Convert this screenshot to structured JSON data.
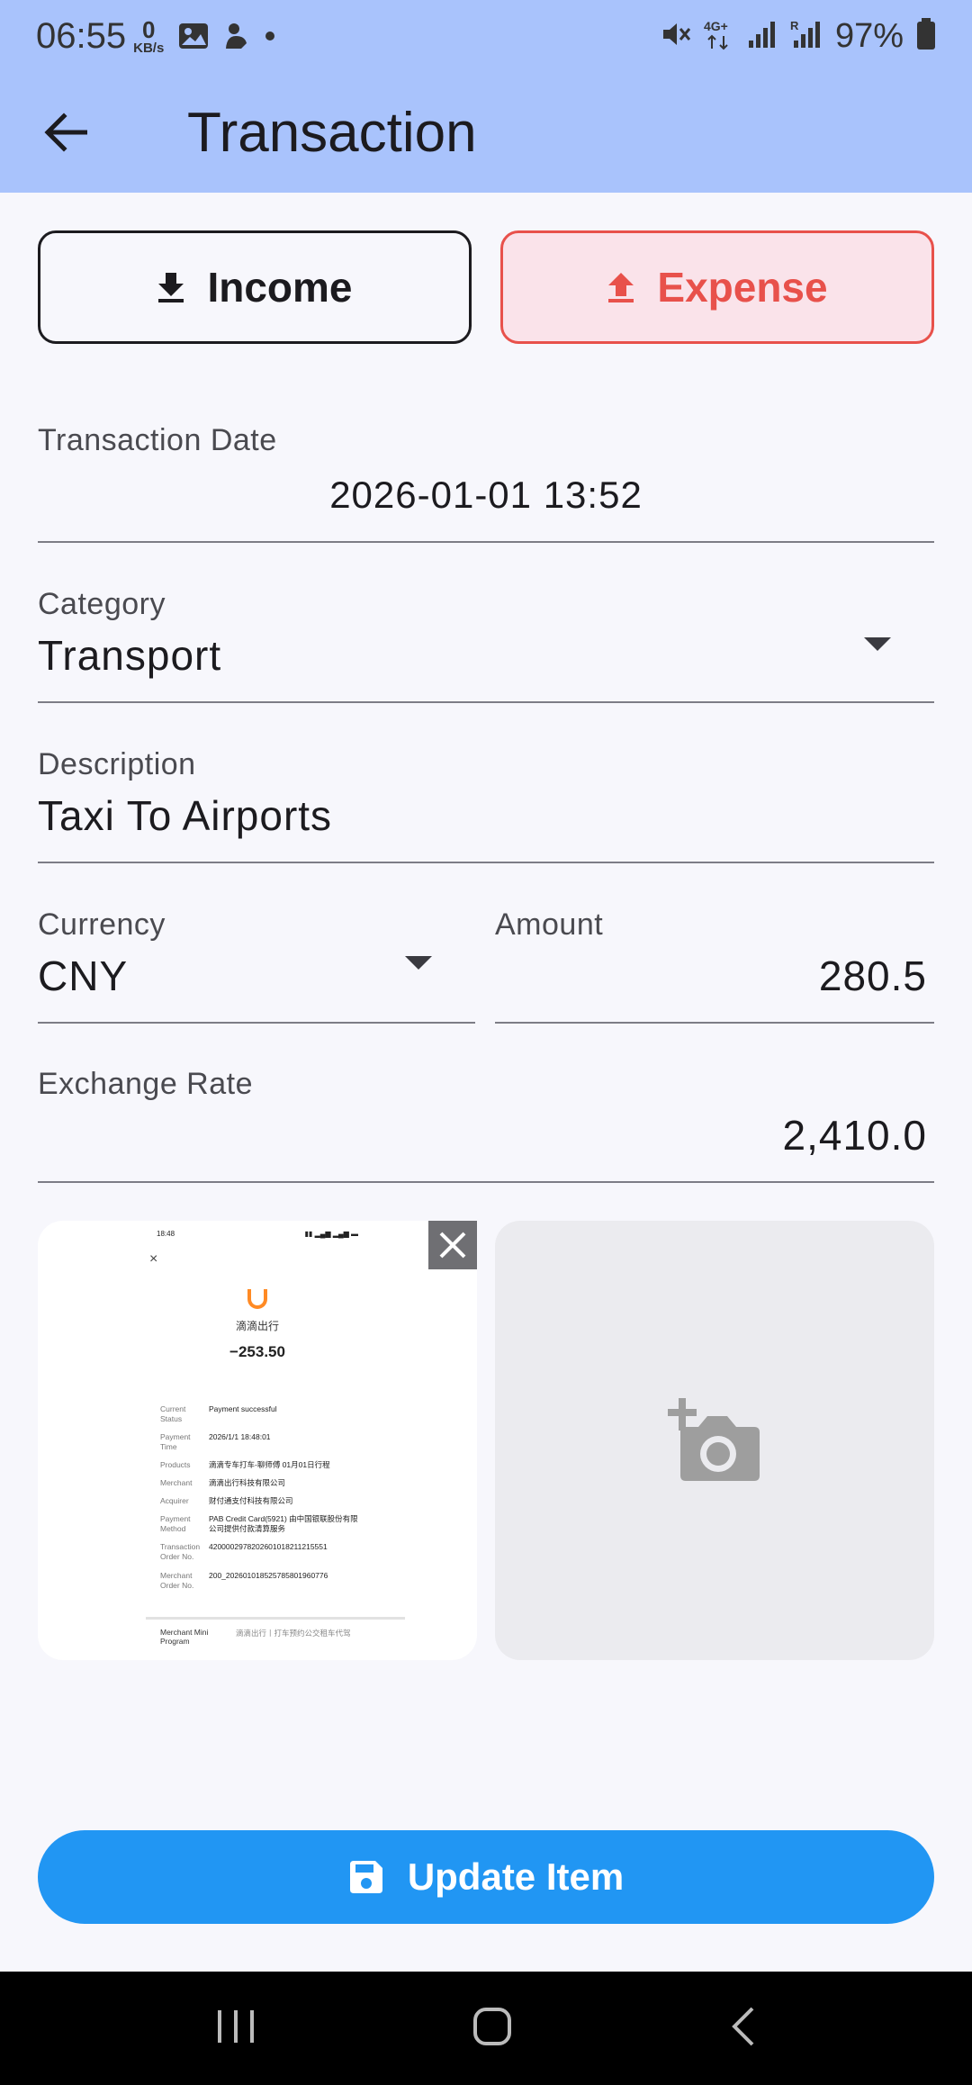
{
  "status_bar": {
    "time": "06:55",
    "net_speed_value": "0",
    "net_speed_unit": "KB/s",
    "battery": "97%"
  },
  "appbar": {
    "title": "Transaction"
  },
  "type_toggle": {
    "income_label": "Income",
    "expense_label": "Expense",
    "selected": "Expense",
    "expense_color": "#e8514b"
  },
  "form": {
    "date": {
      "label": "Transaction Date",
      "value": "2026-01-01 13:52"
    },
    "category": {
      "label": "Category",
      "value": "Transport"
    },
    "description": {
      "label": "Description",
      "value": "Taxi To Airports"
    },
    "currency": {
      "label": "Currency",
      "value": "CNY"
    },
    "amount": {
      "label": "Amount",
      "value": "280.5"
    },
    "exchange_rate": {
      "label": "Exchange Rate",
      "value": "2,410.0"
    }
  },
  "receipt": {
    "status_time": "18:48",
    "merchant_name": "滴滴出行",
    "amount": "−253.50",
    "rows": [
      {
        "k": "Current Status",
        "v": "Payment successful"
      },
      {
        "k": "Payment Time",
        "v": "2026/1/1 18:48:01"
      },
      {
        "k": "Products",
        "v": "滴滴专车打车-聊师傅 01月01日行程"
      },
      {
        "k": "Merchant",
        "v": "滴滴出行科技有限公司"
      },
      {
        "k": "Acquirer",
        "v": "财付通支付科技有限公司"
      },
      {
        "k": "Payment Method",
        "v": "PAB Credit Card(5921) 由中国银联股份有限公司提供付款清算服务"
      },
      {
        "k": "Transaction Order No.",
        "v": "4200002978202601018211215551"
      },
      {
        "k": "Merchant Order No.",
        "v": "200_20260101852578580196077​6"
      }
    ],
    "mini_program_label": "Merchant Mini Program",
    "mini_program_value": "滴滴出行丨打车预约公交租车代驾"
  },
  "actions": {
    "update_label": "Update Item",
    "update_color": "#2196f3"
  },
  "icons": {
    "back": "arrow-left-icon",
    "income": "download-icon",
    "expense": "upload-icon",
    "add_photo": "add-a-photo-icon",
    "remove_photo": "close-icon",
    "save": "save-icon"
  }
}
